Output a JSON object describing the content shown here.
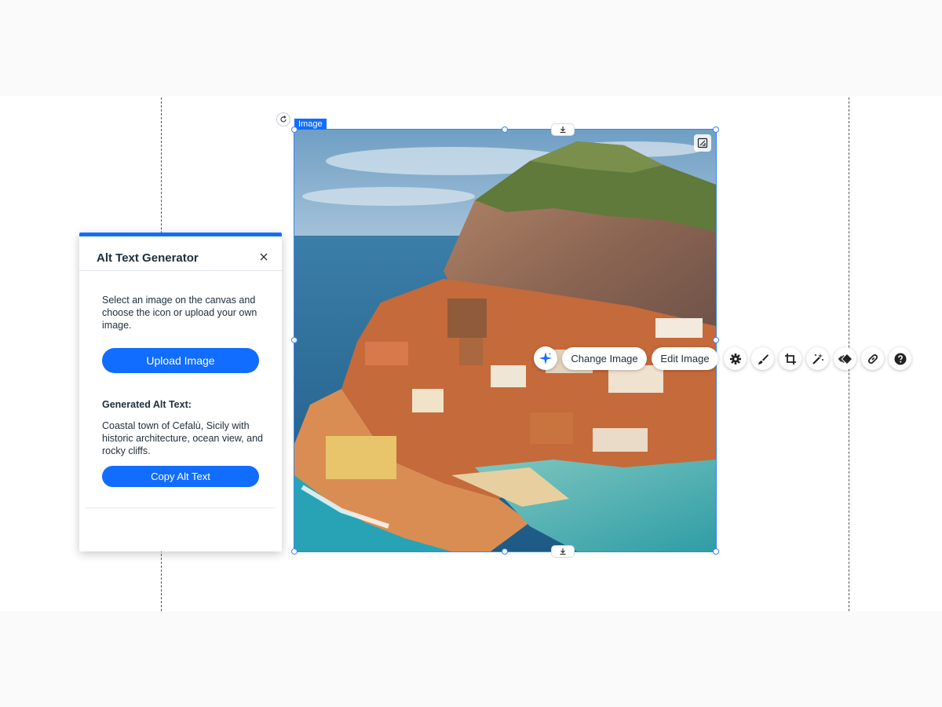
{
  "selection": {
    "tag_label": "Image"
  },
  "toolbar": {
    "change_image_label": "Change Image",
    "edit_image_label": "Edit Image",
    "icons": [
      "sparkle-icon",
      "gear-icon",
      "brush-icon",
      "crop-icon",
      "magic-wand-icon",
      "animation-icon",
      "link-icon",
      "help-icon"
    ]
  },
  "alt_panel": {
    "title": "Alt Text Generator",
    "description": "Select an image on the canvas and choose the icon or upload your own image.",
    "upload_label": "Upload Image",
    "generated_label": "Generated Alt Text:",
    "generated_text": "Coastal town of Cefalù, Sicily with historic architecture, ocean view, and rocky cliffs.",
    "copy_label": "Copy Alt Text"
  },
  "colors": {
    "accent": "#116dff",
    "selection": "#3b82f6",
    "text": "#20303c"
  }
}
